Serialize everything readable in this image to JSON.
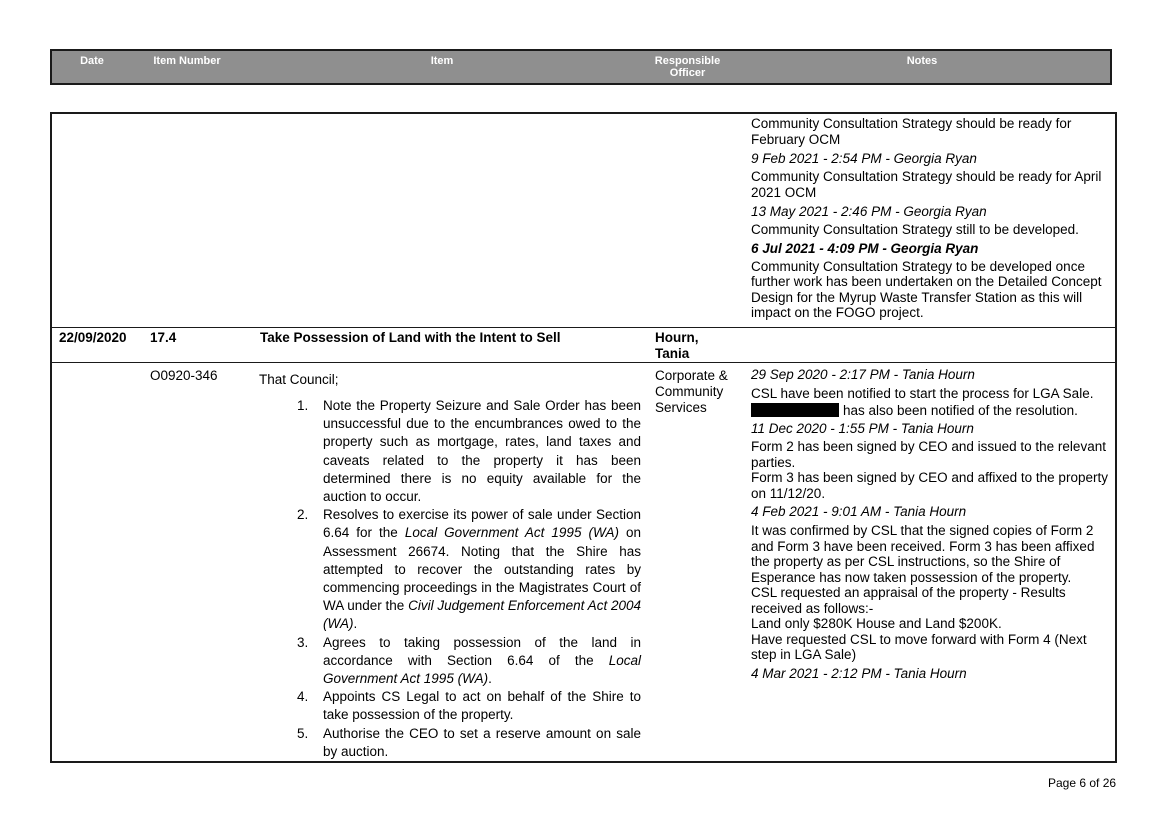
{
  "header": {
    "date": "Date",
    "item_number": "Item Number",
    "item": "Item",
    "responsible_officer": "Responsible Officer",
    "notes": "Notes"
  },
  "prior_notes": {
    "text1": "Community Consultation Strategy should be ready for February OCM",
    "ts1": "9 Feb 2021 - 2:54 PM - Georgia Ryan",
    "text2": "Community Consultation Strategy should be ready for April 2021 OCM",
    "ts2": "13 May 2021 - 2:46 PM - Georgia Ryan",
    "text3": "Community Consultation Strategy still to be developed.",
    "ts3": "6 Jul 2021 - 4:09 PM - Georgia Ryan",
    "text4": "Community Consultation Strategy to be developed once further work has been undertaken on the Detailed Concept Design for the Myrup Waste Transfer Station as this will impact on the FOGO project."
  },
  "item_row": {
    "date": "22/09/2020",
    "item_number": "17.4",
    "title": "Take Possession of Land with the Intent to Sell",
    "officer": "Hourn, Tania"
  },
  "resolution_row": {
    "ref": "O0920-346",
    "intro": "That Council;",
    "department": "Corporate & Community Services",
    "items": [
      {
        "num": "1.",
        "text": "Note the Property Seizure and Sale Order has been unsuccessful due to the encumbrances owed to the property such as mortgage, rates, land taxes and caveats related to the property it has been determined there is no equity available for the auction to occur."
      },
      {
        "num": "2.",
        "pre": "Resolves to exercise its power of sale under Section 6.64 for the ",
        "em1": "Local Government Act 1995 (WA)",
        "mid": " on Assessment 26674. Noting that the Shire has attempted to recover the outstanding rates by commencing proceedings in the Magistrates Court of WA under the ",
        "em2": "Civil Judgement Enforcement Act 2004 (WA)",
        "post": "."
      },
      {
        "num": "3.",
        "pre": "Agrees to taking possession of the land in accordance with Section 6.64 of the ",
        "em1": "Local Government Act 1995 (WA)",
        "post": "."
      },
      {
        "num": "4.",
        "text": "Appoints CS Legal to act on behalf of the Shire to take possession of the property."
      },
      {
        "num": "5.",
        "text": "Authorise the CEO to set a reserve amount on sale by auction."
      }
    ],
    "notes": {
      "ts1": "29 Sep 2020 - 2:17 PM - Tania Hourn",
      "text1a": "CSL have been notified to start the process for LGA Sale.",
      "text1b": "has also been notified of the resolution.",
      "ts2": "11 Dec 2020 - 1:55 PM - Tania Hourn",
      "text2a": "Form 2 has been signed by CEO and issued to the relevant parties.",
      "text2b": "Form 3 has been signed by CEO and affixed to the property on 11/12/20.",
      "ts3": "4 Feb 2021 - 9:01 AM - Tania Hourn",
      "text3a": "It was confirmed by CSL that the signed copies of Form 2 and Form 3 have been received. Form 3 has been affixed the property as per CSL instructions, so the Shire of Esperance has now taken possession of the property.",
      "text3b": "CSL requested an appraisal of the property - Results received as follows:-",
      "text3c": "Land only $280K House and Land $200K.",
      "text3d": "Have requested CSL to move forward with Form 4 (Next step in LGA Sale)",
      "ts4": "4 Mar 2021 - 2:12 PM - Tania Hourn"
    }
  },
  "footer": {
    "page": "Page 6 of 26"
  }
}
